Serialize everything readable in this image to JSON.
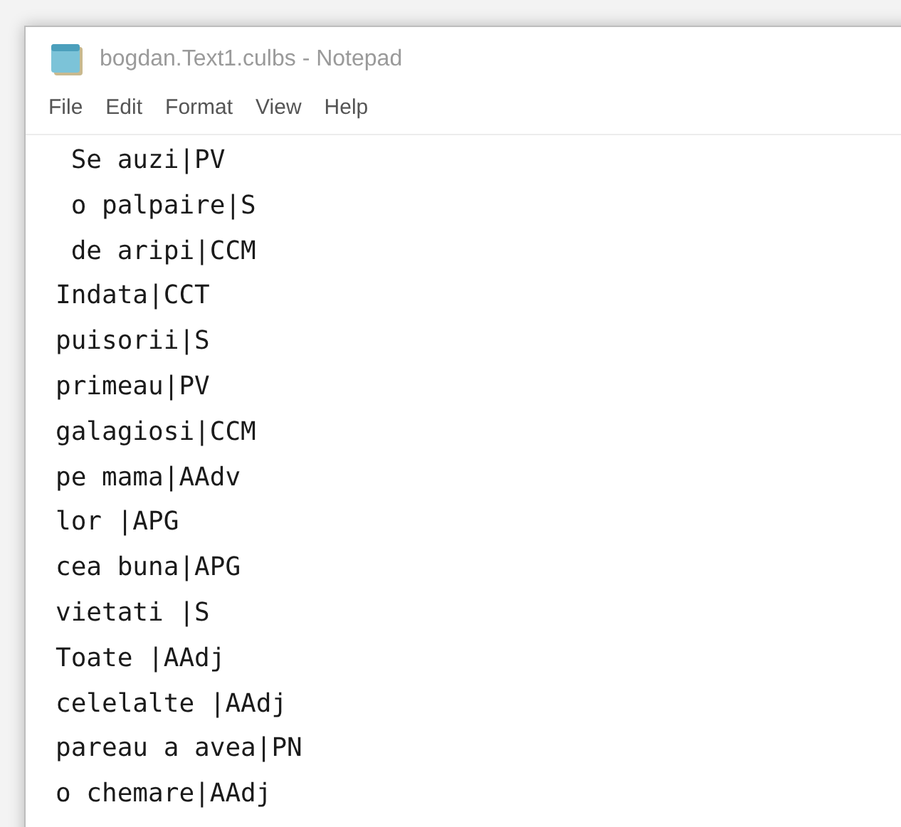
{
  "window": {
    "title": "bogdan.Text1.culbs - Notepad"
  },
  "menu": [
    "File",
    "Edit",
    "Format",
    "View",
    "Help"
  ],
  "lines": [
    " Se auzi|PV",
    " o palpaire|S",
    " de aripi|CCM",
    "Indata|CCT",
    "puisorii|S",
    "primeau|PV",
    "galagiosi|CCM",
    "pe mama|AAdv",
    "lor |APG",
    "cea buna|APG",
    "vietati |S",
    "Toate |AAdj",
    "celelalte |AAdj",
    "pareau a avea|PN",
    "o chemare|AAdj"
  ]
}
